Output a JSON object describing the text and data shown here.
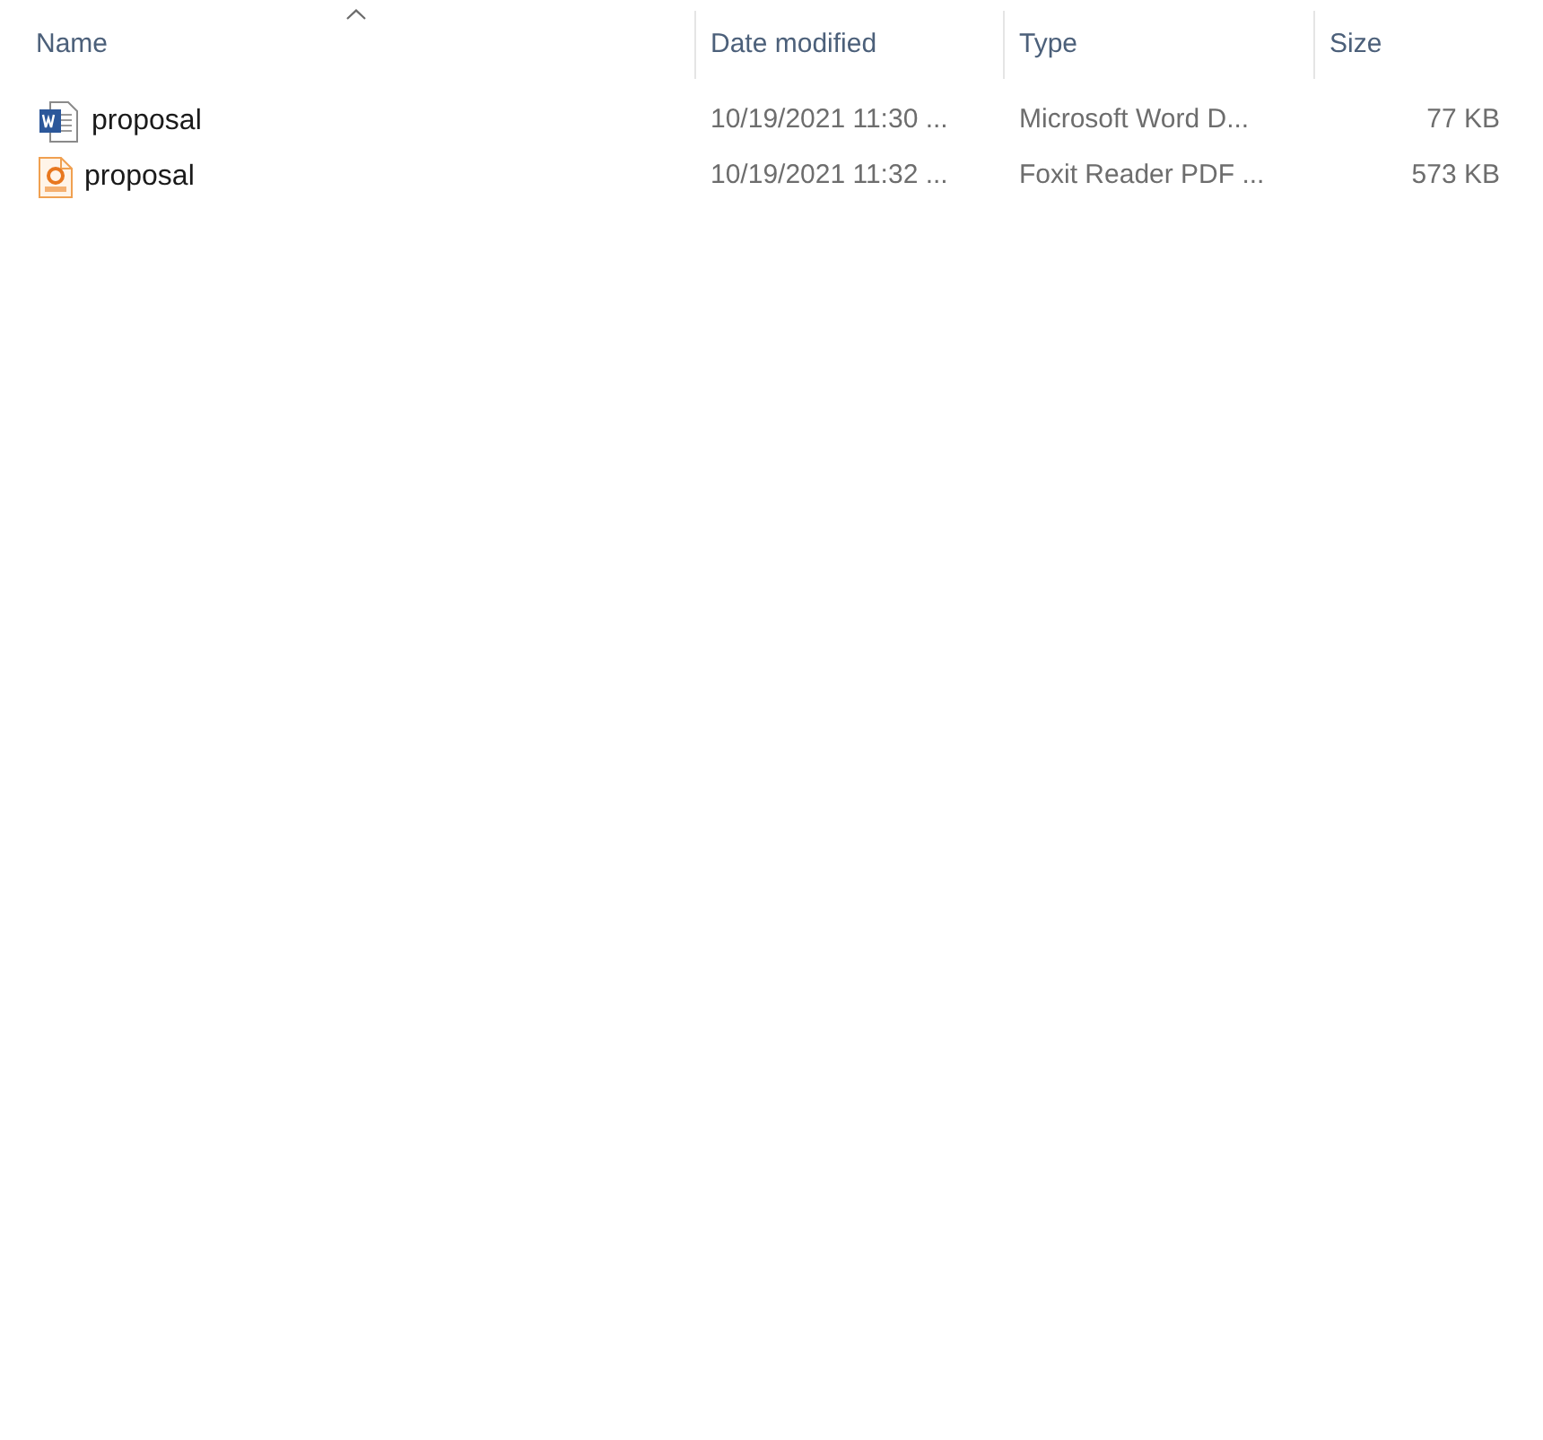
{
  "columns": [
    {
      "label": "Name",
      "sorted": true
    },
    {
      "label": "Date modified",
      "sorted": false
    },
    {
      "label": "Type",
      "sorted": false
    },
    {
      "label": "Size",
      "sorted": false
    }
  ],
  "files": [
    {
      "kind": "word",
      "name": "proposal",
      "date_modified": "10/19/2021 11:30 ...",
      "type": "Microsoft Word D...",
      "size": "77 KB"
    },
    {
      "kind": "pdf",
      "name": "proposal",
      "date_modified": "10/19/2021 11:32 ...",
      "type": "Foxit Reader PDF ...",
      "size": "573 KB"
    }
  ]
}
